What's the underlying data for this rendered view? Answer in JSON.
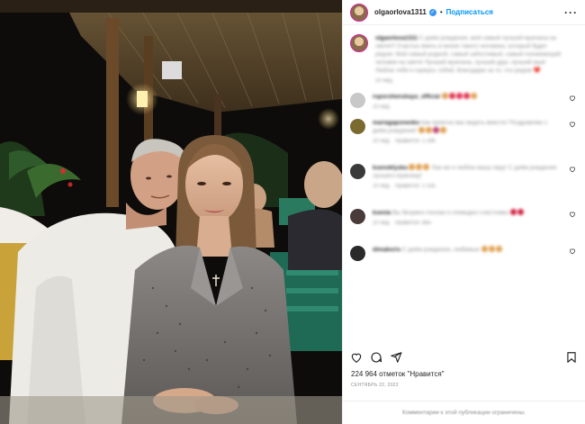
{
  "post": {
    "username": "olgaorlova1311",
    "verified_mark": "✓",
    "dot": "•",
    "follow_label": "Подписаться",
    "more_label": "···"
  },
  "caption": {
    "username": "olgaorlova1311",
    "text": "С днём рождения, мой самый лучший мужчина на свете!!! Счастье иметь в жизни такого человека, который будет рядом. Мой самый родной, самый заботливый, самый понимающий человек на свете! Лучший мужчина, лучший друг, лучший муж! Люблю тебя и горжусь тобой, благодарю за то, что рядом ❤️",
    "time": "20 нед."
  },
  "comments": [
    {
      "username": "ruporshenskaya_official",
      "text": "",
      "time": "20 нед.",
      "likes": "",
      "avatar_color": "#c8c8c8",
      "emoji_colors": [
        "#e0a050",
        "#e03050",
        "#e03050",
        "#e03050",
        "#e0a050"
      ]
    },
    {
      "username": "mariagaponenko",
      "text": "Как приятно вас видеть вместе! Поздравляю с днём рождения!",
      "time": "20 нед.",
      "likes": "Нравится: 1 596",
      "avatar_color": "#7a6a30",
      "emoji_colors": [
        "#e0a050",
        "#e0a050",
        "#c04070",
        "#e0a050"
      ]
    },
    {
      "username": "ksenoklyska",
      "text": "Как же я люблю вашу пару! С днём рождения лучшего мужчину!",
      "time": "20 нед.",
      "likes": "Нравится: 1 535",
      "avatar_color": "#3a3a3a",
      "emoji_colors": [
        "#e0a050",
        "#e0a050",
        "#e0a050",
        "#e0a050",
        "#e0a050"
      ]
    },
    {
      "username": "ksenia",
      "text": "Вы безумно похожи и очевидно счастливы",
      "time": "20 нед.",
      "likes": "Нравится: 885",
      "avatar_color": "#4a3a3a",
      "emoji_colors": [
        "#d02040",
        "#d02040"
      ]
    },
    {
      "username": "dimaboris",
      "text": "С днём рождения, любимые",
      "time": "20 нед.",
      "likes": "Нравится: 1",
      "avatar_color": "#2a2a2a",
      "emoji_colors": [
        "#e0a050",
        "#e0a050",
        "#e0a050"
      ]
    }
  ],
  "stats": {
    "likes": "224 964 отметок \"Нравится\"",
    "date": "СЕНТЯБРЬ 22, 2022"
  },
  "footer": {
    "text": "Комментарии к этой публикации ограничены."
  },
  "colors": {
    "accent": "#0095f6",
    "verified": "#3897f0",
    "muted": "#8e8e8e",
    "text": "#262626"
  },
  "icons": [
    "heart-icon",
    "comment-icon",
    "share-icon",
    "save-icon",
    "more-icon",
    "verified-icon"
  ]
}
